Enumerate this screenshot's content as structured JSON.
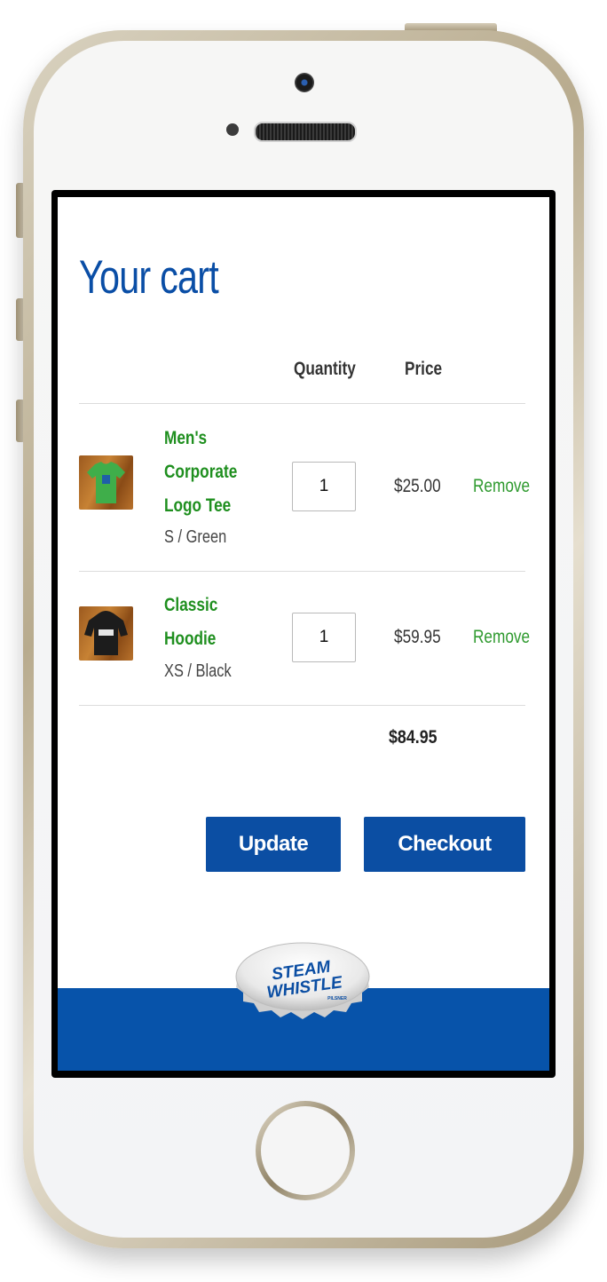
{
  "cart": {
    "title": "Your cart",
    "columns": {
      "quantity": "Quantity",
      "price": "Price"
    },
    "items": [
      {
        "name_lines": [
          "Men's",
          "Corporate",
          "Logo Tee"
        ],
        "variant": "S / Green",
        "quantity": "1",
        "price": "$25.00",
        "remove_label": "Remove",
        "image": "green-tee-thumbnail"
      },
      {
        "name_lines": [
          "Classic",
          "Hoodie"
        ],
        "variant": "XS / Black",
        "quantity": "1",
        "price": "$59.95",
        "remove_label": "Remove",
        "image": "black-hoodie-thumbnail"
      }
    ],
    "total": "$84.95",
    "update_label": "Update",
    "checkout_label": "Checkout"
  },
  "footer": {
    "logo_text_top": "STEAM",
    "logo_text_bottom": "WHISTLE",
    "logo_small": "PILSNER"
  },
  "colors": {
    "brand_blue": "#0b4ea3",
    "product_green": "#1f8f1f",
    "remove_green": "#2f9a2f"
  }
}
